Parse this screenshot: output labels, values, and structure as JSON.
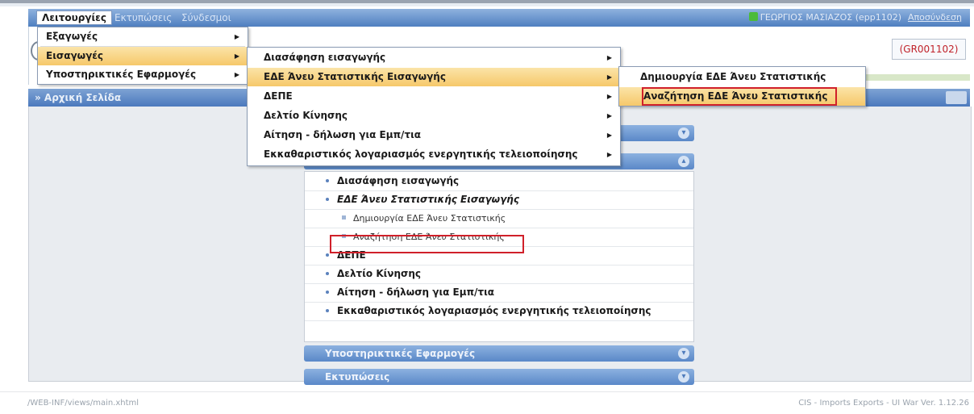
{
  "top_nav": {
    "tabs": [
      "Λειτουργίες",
      "Εκτυπώσεις",
      "Σύνδεσμοι"
    ],
    "user": "ΓΕΩΡΓΙΟΣ ΜΑΣΙΑΖΟΣ (epp1102)",
    "logout": "Αποσύνδεση"
  },
  "header": {
    "code": "(GR001102)"
  },
  "breadcrumb": {
    "home": "» Αρχική Σελίδα"
  },
  "menu1": {
    "items": [
      {
        "label": "Εξαγωγές",
        "arrow": "▶"
      },
      {
        "label": "Εισαγωγές",
        "arrow": "▶"
      },
      {
        "label": "Υποστηρικτικές Εφαρμογές",
        "arrow": "▶"
      }
    ]
  },
  "menu2": {
    "items": [
      {
        "label": "Διασάφηση εισαγωγής",
        "arrow": "▶"
      },
      {
        "label": "ΕΔΕ Άνευ Στατιστικής Εισαγωγής",
        "arrow": "▶"
      },
      {
        "label": "ΔΕΠΕ",
        "arrow": "▶"
      },
      {
        "label": "Δελτίο Κίνησης",
        "arrow": "▶"
      },
      {
        "label": "Αίτηση - δήλωση για Εμπ/τια",
        "arrow": "▶"
      },
      {
        "label": "Εκκαθαριστικός λογαριασμός ενεργητικής τελειοποίησης",
        "arrow": "▶"
      }
    ]
  },
  "menu3": {
    "items": [
      {
        "label": "Δημιουργία ΕΔΕ Άνευ Στατιστικής"
      },
      {
        "label": "Αναζήτηση ΕΔΕ Άνευ Στατιστικής"
      }
    ]
  },
  "panel": {
    "bars": {
      "bar1": "",
      "bar2": "",
      "bar3": "Υποστηρικτικές Εφαρμογές",
      "bar4": "Εκτυπώσεις"
    },
    "chev_down": "▾",
    "chev_up": "▴",
    "rows": [
      "Διασάφηση εισαγωγής",
      "ΕΔΕ Άνευ Στατιστικής Εισαγωγής",
      "Δημιουργία ΕΔΕ Άνευ Στατιστικής",
      "Αναζήτηση ΕΔΕ Άνευ Στατιστικής",
      "ΔΕΠΕ",
      "Δελτίο Κίνησης",
      "Αίτηση - δήλωση για Εμπ/τια",
      "Εκκαθαριστικός λογαριασμός ενεργητικής τελειοποίησης"
    ]
  },
  "footer": {
    "path": "/WEB-INF/views/main.xhtml",
    "version": "CIS - Imports Exports - UI War Ver. 1.12.26"
  },
  "colors": {
    "nav_blue": "#4f7fc0",
    "highlight_orange": "#f6c86a",
    "annotation_red": "#d0202a"
  }
}
